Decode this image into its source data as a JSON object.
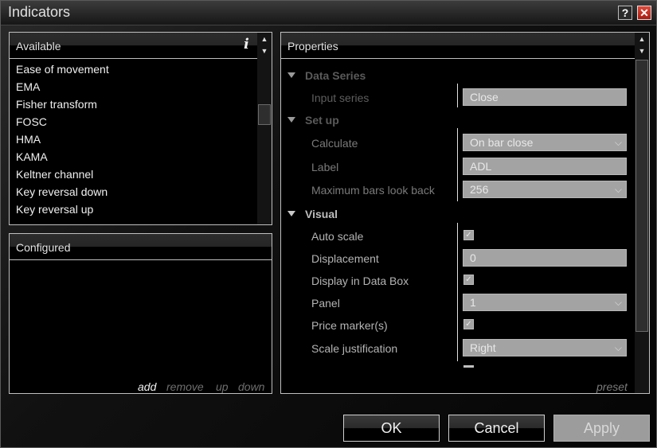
{
  "window": {
    "title": "Indicators",
    "help_label": "?",
    "close_label": "✕"
  },
  "available": {
    "header": "Available",
    "items": [
      "Ease of movement",
      "EMA",
      "Fisher transform",
      "FOSC",
      "HMA",
      "KAMA",
      "Keltner channel",
      "Key reversal down",
      "Key reversal up"
    ]
  },
  "configured": {
    "header": "Configured",
    "actions": {
      "add": "add",
      "remove": "remove",
      "up": "up",
      "down": "down"
    }
  },
  "properties": {
    "header": "Properties",
    "categories": {
      "data_series": "Data Series",
      "setup": "Set up",
      "visual": "Visual"
    },
    "input_series": {
      "label": "Input series",
      "value": "Close"
    },
    "calculate": {
      "label": "Calculate",
      "value": "On bar close"
    },
    "label": {
      "label": "Label",
      "value": "ADL"
    },
    "max_bars": {
      "label": "Maximum bars look back",
      "value": "256"
    },
    "auto_scale": {
      "label": "Auto scale",
      "checked": true
    },
    "displacement": {
      "label": "Displacement",
      "value": "0"
    },
    "display_in_data_box": {
      "label": "Display in Data Box",
      "checked": true
    },
    "panel": {
      "label": "Panel",
      "value": "1"
    },
    "price_markers": {
      "label": "Price marker(s)",
      "checked": true
    },
    "scale_justification": {
      "label": "Scale justification",
      "value": "Right"
    },
    "preset": "preset"
  },
  "buttons": {
    "ok": "OK",
    "cancel": "Cancel",
    "apply": "Apply"
  },
  "glyphs": {
    "check": "✓",
    "chevron": "⌵",
    "up": "▲",
    "down": "▼",
    "info": "i"
  }
}
